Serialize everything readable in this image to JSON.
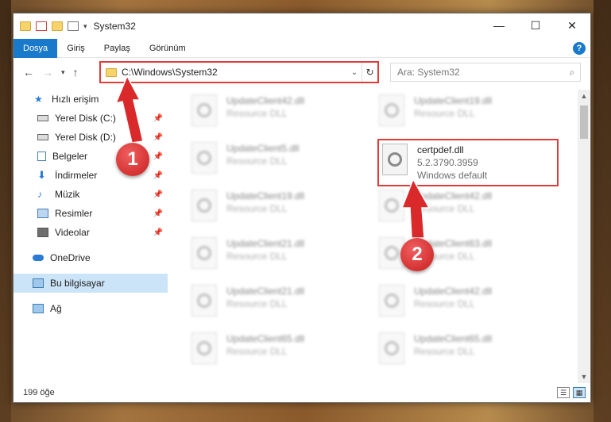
{
  "window": {
    "title": "System32",
    "min_icon": "minimize-icon",
    "max_icon": "maximize-icon",
    "close_icon": "close-icon"
  },
  "ribbon": {
    "tabs": [
      {
        "label": "Dosya",
        "active": true
      },
      {
        "label": "Giriş"
      },
      {
        "label": "Paylaş"
      },
      {
        "label": "Görünüm"
      }
    ]
  },
  "address": {
    "path": "C:\\Windows\\System32"
  },
  "search": {
    "placeholder": "Ara: System32"
  },
  "navpane": {
    "quick_access": "Hızlı erişim",
    "items": [
      {
        "label": "Yerel Disk (C:)",
        "icon": "drive-icon"
      },
      {
        "label": "Yerel Disk (D:)",
        "icon": "drive-icon"
      },
      {
        "label": "Belgeler",
        "icon": "documents-icon"
      },
      {
        "label": "İndirmeler",
        "icon": "downloads-icon"
      },
      {
        "label": "Müzik",
        "icon": "music-icon"
      },
      {
        "label": "Resimler",
        "icon": "pictures-icon"
      },
      {
        "label": "Videolar",
        "icon": "videos-icon"
      }
    ],
    "onedrive": "OneDrive",
    "this_pc": "Bu bilgisayar",
    "network": "Ağ"
  },
  "files_left": [
    {
      "name": "UpdateClient42.dll",
      "type": "Resource DLL"
    },
    {
      "name": "UpdateClient5.dll",
      "type": "Resource DLL"
    },
    {
      "name": "UpdateClient19.dll",
      "type": "Resource DLL"
    },
    {
      "name": "UpdateClient21.dll",
      "type": "Resource DLL"
    },
    {
      "name": "UpdateClient21.dll",
      "type": "Resource DLL"
    },
    {
      "name": "UpdateClient65.dll",
      "type": "Resource DLL"
    }
  ],
  "files_right": [
    {
      "name": "UpdateClient19.dll",
      "type": "Resource DLL"
    },
    {
      "name": "UpdateClient42.dll",
      "type": "Resource DLL"
    },
    {
      "name": "UpdateClient63.dll",
      "type": "Resource DLL"
    },
    {
      "name": "UpdateClient42.dll",
      "type": "Resource DLL"
    },
    {
      "name": "UpdateClient65.dll",
      "type": "Resource DLL"
    }
  ],
  "highlighted_file": {
    "name": "certpdef.dll",
    "version": "5.2.3790.3959",
    "desc": "Windows default"
  },
  "callouts": {
    "one": "1",
    "two": "2"
  },
  "status": {
    "count": "199 öğe"
  },
  "colors": {
    "accent": "#1979ca",
    "callout": "#e03a3a",
    "selected": "#cce4f7"
  }
}
